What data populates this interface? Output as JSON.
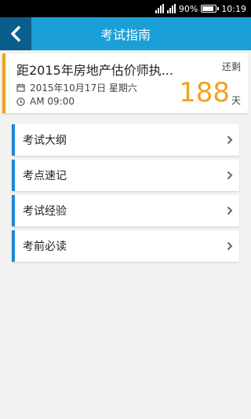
{
  "status_bar": {
    "battery": "90%",
    "time": "10:19"
  },
  "header": {
    "title": "考试指南"
  },
  "countdown": {
    "title": "距2015年房地产估价师执...",
    "remaining_label": "还剩",
    "date": "2015年10月17日 星期六",
    "time": "AM 09:00",
    "days": "188",
    "unit": "天"
  },
  "menu": {
    "items": [
      {
        "label": "考试大纲"
      },
      {
        "label": "考点速记"
      },
      {
        "label": "考试经验"
      },
      {
        "label": "考前必读"
      }
    ]
  },
  "colors": {
    "header": "#1a9fd6",
    "back_button": "#0b5e8c",
    "accent_orange": "#f5a21b",
    "menu_accent": "#1e88d6"
  }
}
